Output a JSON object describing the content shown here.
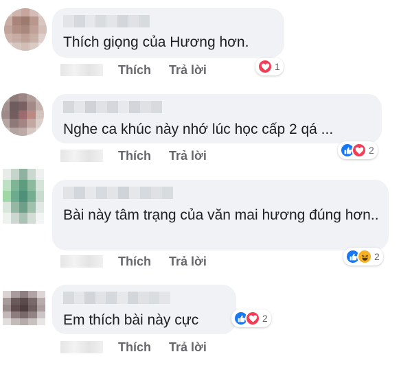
{
  "comments": [
    {
      "text": "Thích giọng của Hương hơn.",
      "like_label": "Thích",
      "reply_label": "Trả lời",
      "reactions": [
        "love"
      ],
      "reaction_count": "1"
    },
    {
      "text": "Nghe ca khúc này nhớ lúc học cấp 2 qá ...",
      "like_label": "Thích",
      "reply_label": "Trả lời",
      "reactions": [
        "like",
        "love"
      ],
      "reaction_count": "2"
    },
    {
      "text": "Bài này tâm trạng của văn mai hương đúng hơn..",
      "like_label": "Thích",
      "reply_label": "Trả lời",
      "reactions": [
        "like",
        "haha"
      ],
      "reaction_count": "2"
    },
    {
      "text": "Em thích bài này cực",
      "like_label": "Thích",
      "reply_label": "Trả lời",
      "reactions": [
        "like",
        "love"
      ],
      "reaction_count": "2"
    }
  ],
  "colors": {
    "like": "#1877f2",
    "love": "#f33e58",
    "haha": "#f7b125",
    "bubble": "#f0f2f5",
    "action_text": "#65676b"
  }
}
